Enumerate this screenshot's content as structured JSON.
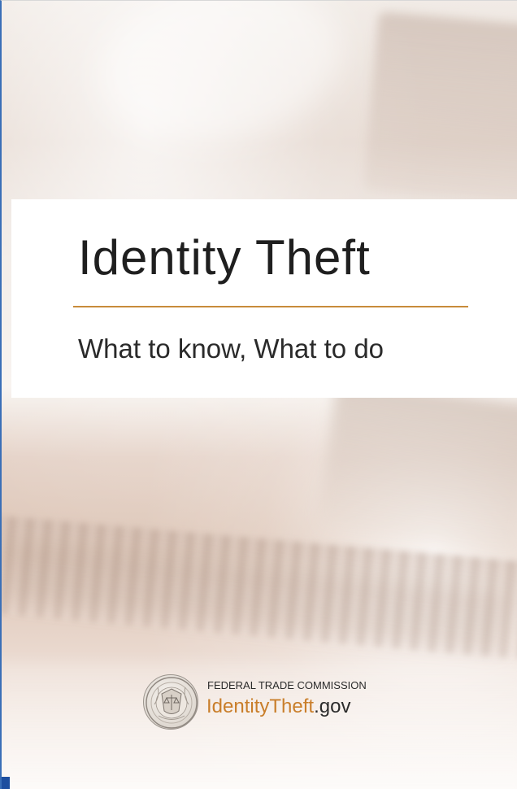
{
  "document": {
    "title": "Identity Theft",
    "subtitle": "What to know, What to do"
  },
  "brand": {
    "organization": "FEDERAL TRADE COMMISSION",
    "site_main": "IdentityTheft",
    "site_suffix": ".gov",
    "seal_icon": "ftc-seal-icon"
  },
  "colors": {
    "accent": "#c88b3a",
    "brand_orange": "#c97e2a",
    "text_dark": "#1f1f1f",
    "left_edge_blue": "#3a6fb7"
  }
}
